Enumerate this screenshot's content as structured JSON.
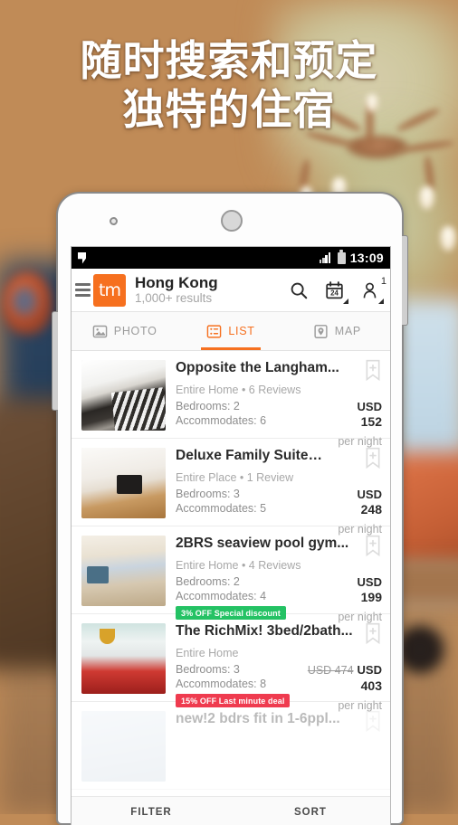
{
  "headline": {
    "line1": "随时搜索和预定",
    "line2": "独特的住宿"
  },
  "colors": {
    "accent": "#f6701f",
    "badge_green": "#24c264",
    "badge_red": "#ef3b4f",
    "status_bar": "#000000"
  },
  "phone": {
    "status_bar": {
      "notification_icon": "notification-glyph",
      "signal_icon": "signal-bars-icon",
      "battery_icon": "battery-icon",
      "time": "13:09"
    },
    "app_bar": {
      "menu_icon": "hamburger-menu-icon",
      "logo_text": "tm",
      "city": "Hong Kong",
      "results": "1,000+ results",
      "search_icon": "search-icon",
      "calendar_icon": "calendar-icon",
      "calendar_day": "24",
      "guests_icon": "person-icon",
      "guests_count": "1"
    },
    "tabs": [
      {
        "label": "PHOTO",
        "icon": "photo-icon",
        "active": false
      },
      {
        "label": "LIST",
        "icon": "list-icon",
        "active": true
      },
      {
        "label": "MAP",
        "icon": "map-pin-icon",
        "active": false
      }
    ],
    "listings": [
      {
        "title": "Opposite the Langham...",
        "subtitle": "Entire Home  •  6 Reviews",
        "bedrooms": "Bedrooms: 2",
        "accommodates": "Accommodates: 6",
        "badge": "",
        "badge_type": "",
        "old_price": "",
        "currency": "USD",
        "price": "152",
        "per": "per night",
        "save_icon": "bookmark-add-icon"
      },
      {
        "title": "Deluxe Family Suite…",
        "subtitle": "Entire Place  •  1 Review",
        "bedrooms": "Bedrooms: 3",
        "accommodates": "Accommodates: 5",
        "badge": "",
        "badge_type": "",
        "old_price": "",
        "currency": "USD",
        "price": "248",
        "per": "per night",
        "save_icon": "bookmark-add-icon"
      },
      {
        "title": "2BRS seaview pool gym...",
        "subtitle": "Entire Home  •  4 Reviews",
        "bedrooms": "Bedrooms: 2",
        "accommodates": "Accommodates: 4",
        "badge": "3% OFF Special discount",
        "badge_type": "green",
        "old_price": "",
        "currency": "USD",
        "price": "199",
        "per": "per night",
        "save_icon": "bookmark-add-icon"
      },
      {
        "title": "The RichMix! 3bed/2bath...",
        "subtitle": "Entire Home",
        "bedrooms": "Bedrooms: 3",
        "accommodates": "Accommodates: 8",
        "badge": "15% OFF Last minute deal",
        "badge_type": "red",
        "old_price": "USD 474",
        "currency": "USD",
        "price": "403",
        "per": "per night",
        "save_icon": "bookmark-add-icon"
      },
      {
        "title": "new!2 bdrs fit in 1-6ppl...",
        "subtitle": "",
        "bedrooms": "",
        "accommodates": "",
        "badge": "",
        "badge_type": "",
        "old_price": "",
        "currency": "",
        "price": "",
        "per": "",
        "save_icon": "bookmark-add-icon"
      }
    ],
    "footer": {
      "filter_label": "FILTER",
      "sort_label": "SORT"
    }
  }
}
